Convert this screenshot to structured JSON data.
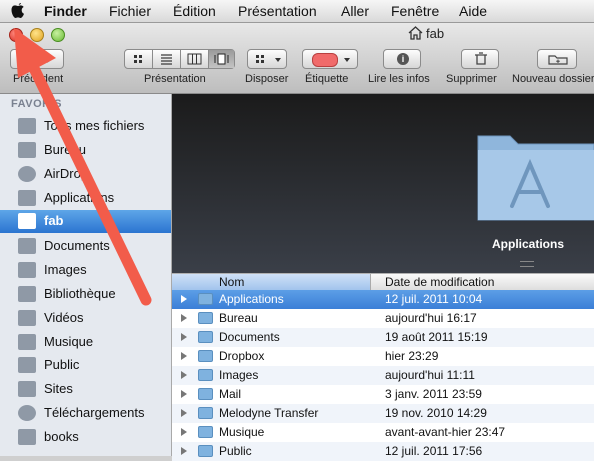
{
  "menubar": {
    "items": [
      "Finder",
      "Fichier",
      "Édition",
      "Présentation",
      "Aller",
      "Fenêtre",
      "Aide"
    ]
  },
  "window": {
    "title": "fab"
  },
  "toolbar": {
    "back_label": "Précédent",
    "view_label": "Présentation",
    "arrange_label": "Disposer",
    "tag_label": "Étiquette",
    "info_label": "Lire les infos",
    "delete_label": "Supprimer",
    "newfolder_label": "Nouveau dossier",
    "tag_color": "#f06a6a"
  },
  "sidebar": {
    "header": "FAVORIS",
    "items": [
      {
        "label": "Tous mes fichiers",
        "icon": "all-files-icon"
      },
      {
        "label": "Bureau",
        "icon": "desktop-icon"
      },
      {
        "label": "AirDrop",
        "icon": "airdrop-icon"
      },
      {
        "label": "Applications",
        "icon": "applications-icon"
      },
      {
        "label": "fab",
        "icon": "home-icon"
      },
      {
        "label": "Documents",
        "icon": "documents-icon"
      },
      {
        "label": "Images",
        "icon": "camera-icon"
      },
      {
        "label": "Bibliothèque",
        "icon": "folder-icon"
      },
      {
        "label": "Vidéos",
        "icon": "film-icon"
      },
      {
        "label": "Musique",
        "icon": "music-icon"
      },
      {
        "label": "Public",
        "icon": "folder-icon"
      },
      {
        "label": "Sites",
        "icon": "folder-icon"
      },
      {
        "label": "Téléchargements",
        "icon": "download-icon"
      },
      {
        "label": "books",
        "icon": "folder-icon"
      }
    ],
    "selected": "fab",
    "selection_color": "#3b7fd7"
  },
  "coverflow": {
    "title": "Applications"
  },
  "list": {
    "columns": [
      "Nom",
      "Date de modification"
    ],
    "rows": [
      {
        "name": "Applications",
        "date": "12 juil. 2011 10:04"
      },
      {
        "name": "Bureau",
        "date": "aujourd'hui 16:17"
      },
      {
        "name": "Documents",
        "date": "19 août 2011 15:19"
      },
      {
        "name": "Dropbox",
        "date": "hier 23:29"
      },
      {
        "name": "Images",
        "date": "aujourd'hui 11:11"
      },
      {
        "name": "Mail",
        "date": "3 janv. 2011 23:59"
      },
      {
        "name": "Melodyne Transfer",
        "date": "19 nov. 2010 14:29"
      },
      {
        "name": "Musique",
        "date": "avant-avant-hier 23:47"
      },
      {
        "name": "Public",
        "date": "12 juil. 2011 17:56"
      }
    ],
    "selected": "Applications"
  },
  "annotation": {
    "arrow_color": "#f25c4a"
  }
}
